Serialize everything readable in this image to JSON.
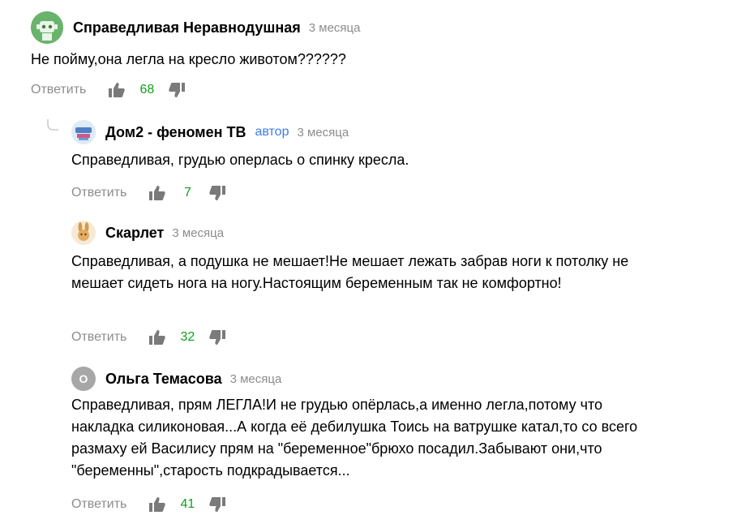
{
  "comments": [
    {
      "author": "Справедливая Неравнодушная",
      "time": "3 месяца",
      "text": "Не пойму,она легла на кресло животом??????",
      "reply_label": "Ответить",
      "likes": "68",
      "avatar_icon": "robot-avatar-icon"
    },
    {
      "author": "Дом2 - феномен ТВ",
      "badge": "автор",
      "time": "3 месяца",
      "text": "Справедливая, грудью оперлась о спинку кресла.",
      "reply_label": "Ответить",
      "likes": "7",
      "avatar_icon": "channel-logo-avatar-icon"
    },
    {
      "author": "Скарлет",
      "time": "3 месяца",
      "text": "Справедливая, а подушка не мешает!Не мешает лежать забрав ноги к потолку не мешает сидеть нога на ногу.Настоящим беременным так не комфортно!",
      "reply_label": "Ответить",
      "likes": "32",
      "avatar_icon": "bunny-avatar-icon"
    },
    {
      "author": "Ольга Темасова",
      "time": "3 месяца",
      "text": "Справедливая, прям ЛЕГЛА!И не грудью опёрлась,а именно легла,потому что накладка силиконовая...А когда её дебилушка Тоись на ватрушке катал,то со всего размаху ей Василису прям на \"беременное\"брюхо посадил.Забывают они,что \"беременны\",старость подкрадывается...",
      "reply_label": "Ответить",
      "likes": "41",
      "avatar_letter": "О"
    }
  ],
  "colors": {
    "likes": "#0ea31a",
    "meta": "#8c8c8c",
    "author_badge": "#3b7ee8"
  }
}
